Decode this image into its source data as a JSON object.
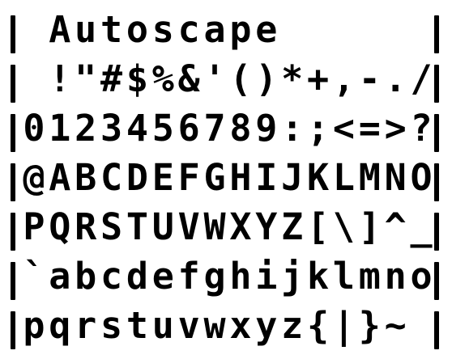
{
  "font_name": "Autoscape",
  "specimen_rows": [
    [
      " ",
      "A",
      "u",
      "t",
      "o",
      "s",
      "c",
      "a",
      "p",
      "e",
      " ",
      " ",
      " ",
      " ",
      " ",
      " "
    ],
    [
      " ",
      "!",
      "\"",
      "#",
      "$",
      "%",
      "&",
      "'",
      "(",
      ")",
      "*",
      "+",
      ",",
      "-",
      ".",
      "/"
    ],
    [
      "0",
      "1",
      "2",
      "3",
      "4",
      "5",
      "6",
      "7",
      "8",
      "9",
      ":",
      ";",
      "<",
      "=",
      ">",
      "?"
    ],
    [
      "@",
      "A",
      "B",
      "C",
      "D",
      "E",
      "F",
      "G",
      "H",
      "I",
      "J",
      "K",
      "L",
      "M",
      "N",
      "O"
    ],
    [
      "P",
      "Q",
      "R",
      "S",
      "T",
      "U",
      "V",
      "W",
      "X",
      "Y",
      "Z",
      "[",
      "\\",
      "]",
      "^",
      "_"
    ],
    [
      "`",
      "a",
      "b",
      "c",
      "d",
      "e",
      "f",
      "g",
      "h",
      "i",
      "j",
      "k",
      "l",
      "m",
      "n",
      "o"
    ],
    [
      "p",
      "q",
      "r",
      "s",
      "t",
      "u",
      "v",
      "w",
      "x",
      "y",
      "z",
      "{",
      "|",
      "}",
      "~",
      " "
    ]
  ],
  "colors": {
    "ink": "#000000",
    "background": "#ffffff"
  }
}
